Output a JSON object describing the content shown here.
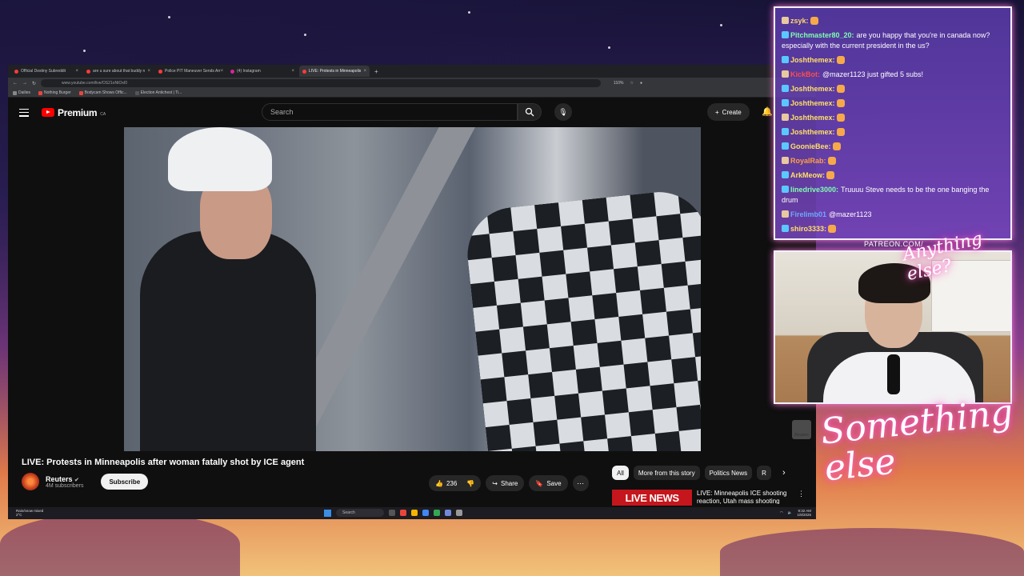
{
  "browser": {
    "tabs": [
      {
        "label": "Official Destiny Subreddit"
      },
      {
        "label": "are u sure about that buddy n"
      },
      {
        "label": "Police PIT Maneuver Sends Arr"
      },
      {
        "label": "(4) Instagram"
      },
      {
        "label": "LIVE: Protests in Minneapolis"
      }
    ],
    "url": "www.youtube.com/live/OS21oNtOxI0",
    "zoom": "110%",
    "bookmarks": [
      {
        "label": "Dailies"
      },
      {
        "label": "Nothing Burger"
      },
      {
        "label": "Bodycam Shows Offic..."
      },
      {
        "label": "Election Antichest | Ti..."
      }
    ]
  },
  "youtube": {
    "logo_label": "Premium",
    "region": "CA",
    "search_placeholder": "Search",
    "create_label": "Create",
    "video_title": "LIVE: Protests in Minneapolis after woman fatally shot by ICE agent",
    "watermark": "Reuters",
    "channel": {
      "name": "Reuters",
      "subs": "4M subscribers",
      "subscribe_label": "Subscribe"
    },
    "likes": "236",
    "share_label": "Share",
    "save_label": "Save",
    "chips": [
      {
        "label": "All"
      },
      {
        "label": "More from this story"
      },
      {
        "label": "Politics News"
      },
      {
        "label": "R"
      }
    ],
    "rec": {
      "thumb": "LIVE NEWS",
      "title": "LIVE: Minneapolis ICE shooting reaction, Utah mass shooting"
    }
  },
  "taskbar": {
    "weather_line1": "Rain/snow mixed",
    "weather_line2": "2°C",
    "search_label": "Search",
    "time": "9:32 AM",
    "date": "1/8/2026"
  },
  "chat": {
    "messages": [
      {
        "user": "zsyk:",
        "text": "",
        "color": "#ffd86b"
      },
      {
        "user": "Pitchmaster80_20:",
        "text": "are you happy that you're in canada now? especially with the current president in the us?",
        "color": "#7fffb0"
      },
      {
        "user": "Joshthemex:",
        "text": "",
        "color": "#ffe066"
      },
      {
        "user": "KickBot:",
        "text": "@mazer1123 just gifted 5 subs!",
        "color": "#ff4d4d"
      },
      {
        "user": "Joshthemex:",
        "text": "",
        "color": "#ffe066"
      },
      {
        "user": "Joshthemex:",
        "text": "",
        "color": "#ffe066"
      },
      {
        "user": "Joshthemex:",
        "text": "",
        "color": "#ffe066"
      },
      {
        "user": "Joshthemex:",
        "text": "",
        "color": "#ffe066"
      },
      {
        "user": "GoonieBee:",
        "text": "",
        "color": "#ffe066"
      },
      {
        "user": "RoyalRab:",
        "text": "",
        "color": "#ff9f43"
      },
      {
        "user": "ArkMeow:",
        "text": "",
        "color": "#ffe066"
      },
      {
        "user": "linedrive3000:",
        "text": "Truuuu Steve needs to be the one banging the drum",
        "color": "#7fffb0"
      },
      {
        "user": "Firelimb01",
        "text": "@mazer1123",
        "color": "#6ea8ff"
      },
      {
        "user": "shiro3333:",
        "text": "",
        "color": "#ffe066"
      }
    ]
  },
  "overlay": {
    "patreon": "PATREON.COM/",
    "signature_top": "Anything else?",
    "signature_main": "Something else"
  }
}
